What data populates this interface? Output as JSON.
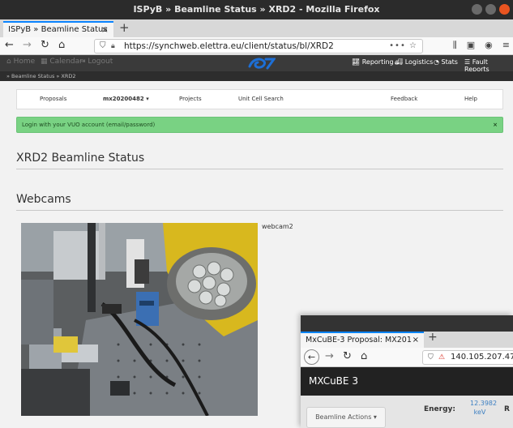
{
  "window": {
    "title": "ISPyB » Beamline Status » XRD2 - Mozilla Firefox"
  },
  "browser": {
    "tab_title": "ISPyB » Beamline Status",
    "tab_close": "×",
    "new_tab": "+",
    "url": "https://synchweb.elettra.eu/client/status/bl/XRD2",
    "url_more": "•••"
  },
  "app": {
    "left_links": [
      {
        "label": "Home"
      },
      {
        "label": "Calendar"
      },
      {
        "label": "Logout"
      }
    ],
    "right_links": [
      {
        "label": "Reporting"
      },
      {
        "label": "Logistics"
      },
      {
        "label": "Stats"
      },
      {
        "label": "Fault Reports"
      }
    ],
    "breadcrumb": "» Beamline Status » XRD2",
    "logo_color": "#1d6fd6"
  },
  "menu": {
    "items": [
      {
        "label": "Proposals"
      },
      {
        "label": "mx20200482 ▾"
      },
      {
        "label": "Projects"
      },
      {
        "label": "Unit Cell Search"
      },
      {
        "label": "Feedback"
      },
      {
        "label": "Help"
      }
    ]
  },
  "alert": {
    "text": "Login with your VUO account (email/password)",
    "close": "×",
    "color": "#79d283"
  },
  "page": {
    "title": "XRD2 Beamline Status",
    "webcams_heading": "Webcams",
    "webcam_label": "webcam2"
  },
  "window2": {
    "tab_title": "MxCuBE-3 Proposal: MX201",
    "tab_close": "×",
    "new_tab": "+",
    "url": "140.105.207.47",
    "app_title": "MXCuBE 3",
    "actions_label": "Beamline Actions ▾",
    "energy_label": "Energy:",
    "energy_value": "12.3982",
    "energy_unit": "keV",
    "truncated_label": "R"
  }
}
